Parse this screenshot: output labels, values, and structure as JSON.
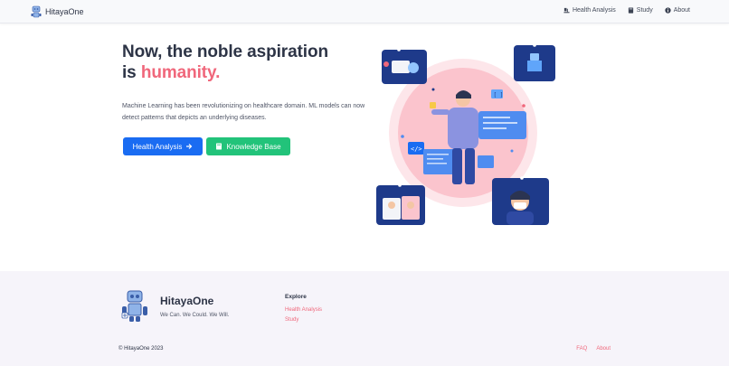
{
  "navbar": {
    "brand": "HitayaOne",
    "links": [
      {
        "label": "Health Analysis",
        "icon": "microscope-icon"
      },
      {
        "label": "Study",
        "icon": "book-icon"
      },
      {
        "label": "About",
        "icon": "info-icon"
      }
    ]
  },
  "hero": {
    "title_line1": "Now, the noble aspiration",
    "title_prefix": "is",
    "title_accent": "humanity.",
    "description": "Machine Learning has been revolutionizing on healthcare domain. ML models can now detect patterns that depicts an underlying diseases.",
    "buttons": [
      {
        "label": "Health Analysis",
        "icon": "arrow-right-icon"
      },
      {
        "label": "Knowledge Base",
        "icon": "book-icon"
      }
    ]
  },
  "footer": {
    "brand": "HitayaOne",
    "tagline": "We Can. We Could. We Will.",
    "explore_heading": "Explore",
    "explore_links": [
      "Health Analysis",
      "Study"
    ],
    "copyright": "© HitayaOne 2023",
    "bottom_links": [
      "FAQ",
      "About"
    ]
  },
  "colors": {
    "accent": "#f0677b",
    "primary": "#1a6cf2",
    "success": "#22c37a",
    "text": "#2d3446",
    "footer_bg": "#f6f4fa"
  }
}
